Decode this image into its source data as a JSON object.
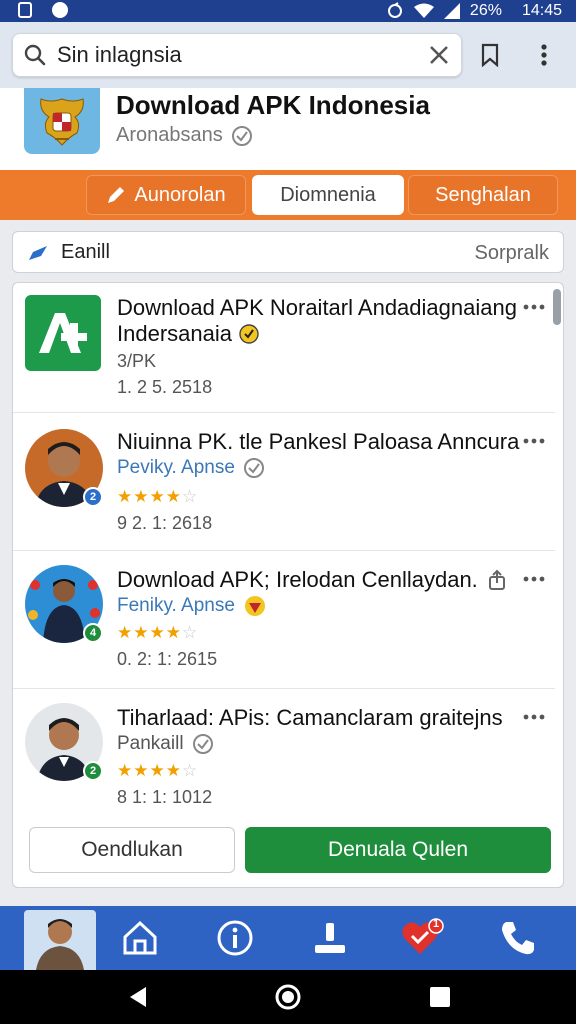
{
  "status_bar": {
    "battery": "26%",
    "time": "14:45"
  },
  "search": {
    "value": "Sin inlagnsia",
    "placeholder": ""
  },
  "app": {
    "title": "Download APK Indonesia",
    "subtitle": "Aronabsans"
  },
  "tabs": [
    {
      "label": "Aunorolan"
    },
    {
      "label": "Diomnenia"
    },
    {
      "label": "Senghalan"
    }
  ],
  "filter": {
    "left_label": "Eanill",
    "right_label": "Sorpralk"
  },
  "items": [
    {
      "title_line1": "Download APK Noraitarl Andadiagnaiang",
      "title_line2": "Indersanaia",
      "sub": "3/PK",
      "meta": "1. 2 5. 2518"
    },
    {
      "title": "Niuinna PK. tle Pankesl Paloasa Anncura",
      "sub": "Peviky. Apnse",
      "rating": 4,
      "meta": "9 2. 1: 2618",
      "badge": "2"
    },
    {
      "title": "Download APK; Irelodan Cenllaydan.",
      "sub": "Feniky. Apnse",
      "rating": 4,
      "meta": "0. 2: 1: 2615",
      "badge": "4"
    },
    {
      "title": "Tiharlaad: APis: Camanclaram graitejns",
      "sub": "Pankaill",
      "rating": 4,
      "meta": "8 1: 1: 1012",
      "badge": "2"
    }
  ],
  "buttons": {
    "secondary": "Oendlukan",
    "primary": "Denuala Qulen"
  },
  "bottom_nav": {
    "heart_count": "1"
  },
  "colors": {
    "accent_orange": "#ee7a2c",
    "nav_blue": "#2e63c4",
    "primary_green": "#1f8e3c",
    "star": "#f1a000"
  }
}
